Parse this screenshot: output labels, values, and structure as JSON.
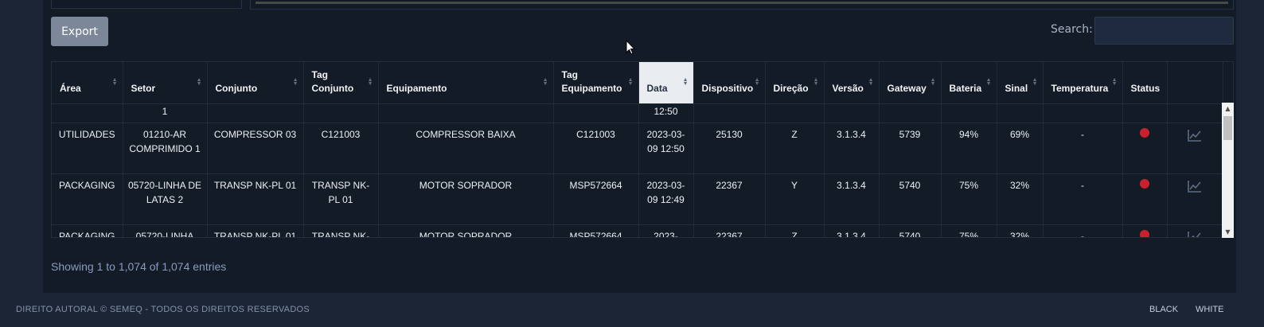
{
  "toolbar": {
    "export_label": "Export",
    "search_label": "Search:",
    "search_value": ""
  },
  "table": {
    "columns": [
      "Área",
      "Setor",
      "Conjunto",
      "Tag Conjunto",
      "Equipamento",
      "Tag Equipamento",
      "Data",
      "Dispositivo",
      "Direção",
      "Versão",
      "Gateway",
      "Bateria",
      "Sinal",
      "Temperatura",
      "Status"
    ],
    "sorted_column": "Data",
    "top_partial": {
      "setor": "1",
      "data": "12:50"
    },
    "rows": [
      {
        "area": "UTILIDADES",
        "setor": "01210-AR COMPRIMIDO 1",
        "conjunto": "COMPRESSOR 03",
        "tag_conjunto": "C121003",
        "equipamento": "COMPRESSOR BAIXA",
        "tag_equipamento": "C121003",
        "data": "2023-03-09 12:50",
        "dispositivo": "25130",
        "direcao": "Z",
        "versao": "3.1.3.4",
        "gateway": "5739",
        "bateria": "94%",
        "sinal": "69%",
        "temperatura": "-",
        "status": "red"
      },
      {
        "area": "PACKAGING",
        "setor": "05720-LINHA DE LATAS 2",
        "conjunto": "TRANSP NK-PL 01",
        "tag_conjunto": "TRANSP NK-PL 01",
        "equipamento": "MOTOR SOPRADOR",
        "tag_equipamento": "MSP572664",
        "data": "2023-03-09 12:49",
        "dispositivo": "22367",
        "direcao": "Y",
        "versao": "3.1.3.4",
        "gateway": "5740",
        "bateria": "75%",
        "sinal": "32%",
        "temperatura": "-",
        "status": "red"
      },
      {
        "area": "PACKAGING",
        "setor": "05720-LINHA",
        "conjunto": "TRANSP NK-PL 01",
        "tag_conjunto": "TRANSP NK-",
        "equipamento": "MOTOR SOPRADOR",
        "tag_equipamento": "MSP572664",
        "data": "2023-",
        "dispositivo": "22367",
        "direcao": "Z",
        "versao": "3.1.3.4",
        "gateway": "5740",
        "bateria": "75%",
        "sinal": "32%",
        "temperatura": "-",
        "status": "red"
      }
    ]
  },
  "pagination": {
    "info": "Showing 1 to 1,074 of 1,074 entries"
  },
  "footer": {
    "copyright": "DIREITO AUTORAL © SEMEQ - TODOS OS DIREITOS RESERVADOS",
    "theme_black": "BLACK",
    "theme_white": "WHITE"
  },
  "colors": {
    "status_red": "#c8202f",
    "panel_bg": "#131b27",
    "page_bg": "#1b2536"
  },
  "icons": {
    "row_action": "chart-line-icon",
    "status": "status-dot-icon"
  }
}
